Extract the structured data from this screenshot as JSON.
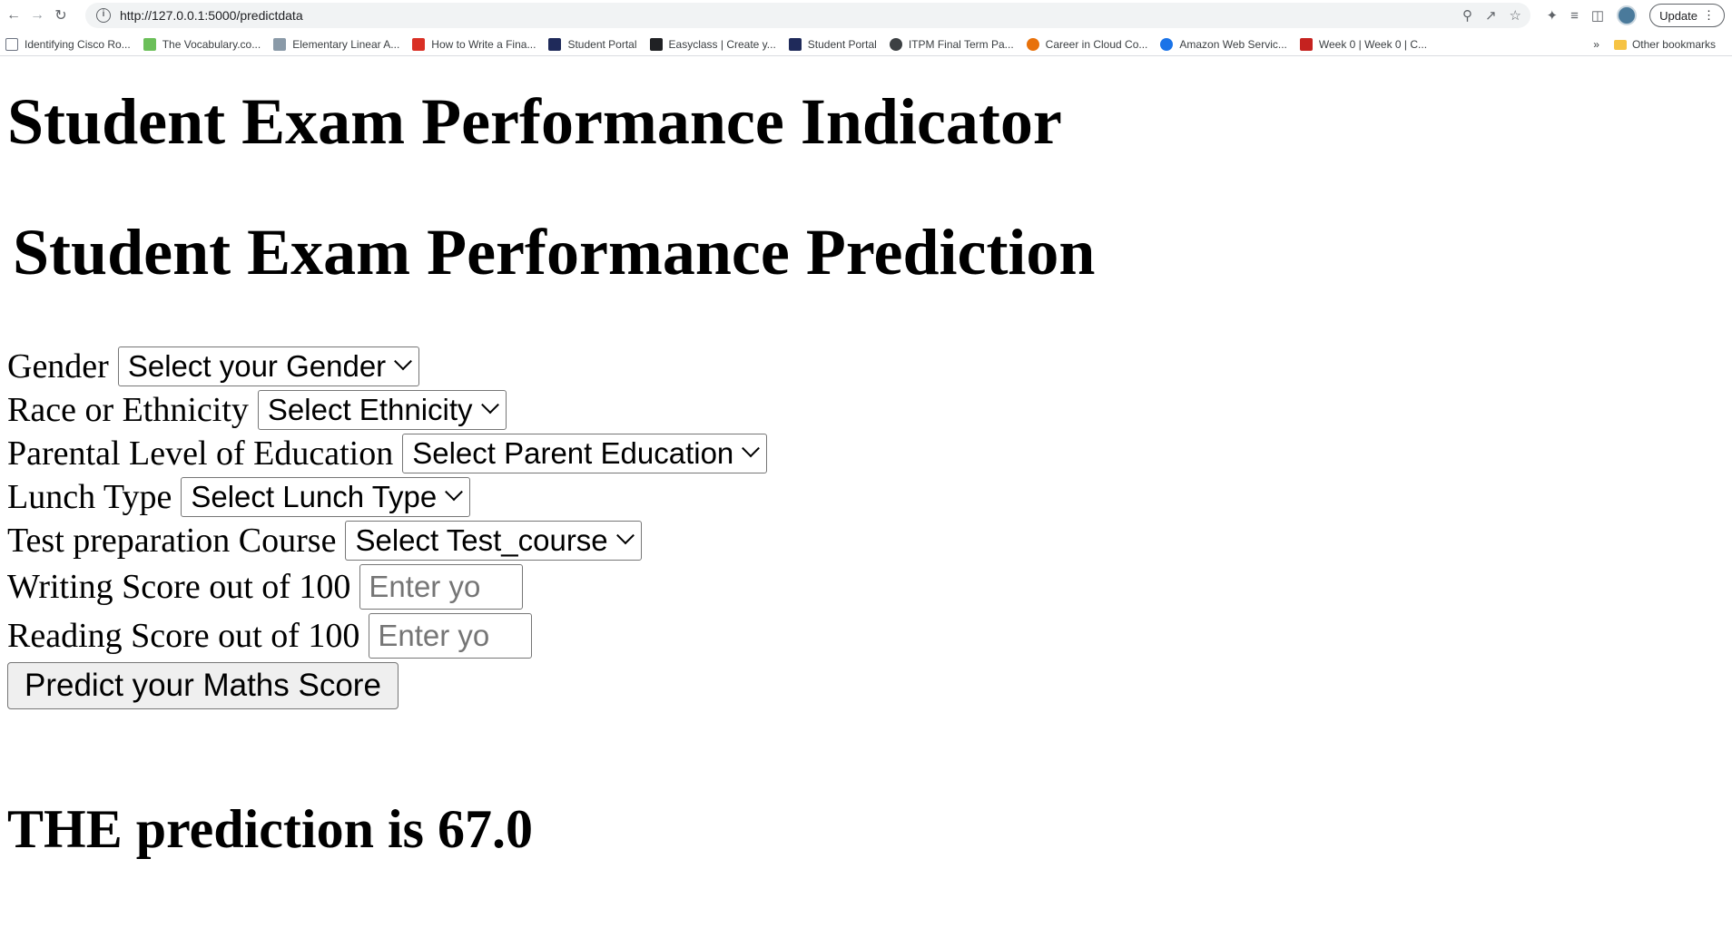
{
  "browser": {
    "url": "http://127.0.0.1:5000/predictdata",
    "update_label": "Update",
    "bookmarks": [
      {
        "label": "Identifying Cisco Ro...",
        "color": "#6b7280"
      },
      {
        "label": "The Vocabulary.co...",
        "color": "#6bbf59"
      },
      {
        "label": "Elementary Linear A...",
        "color": "#8a9aa8"
      },
      {
        "label": "How to Write a Fina...",
        "color": "#d93025"
      },
      {
        "label": "Student Portal",
        "color": "#1f2a5a"
      },
      {
        "label": "Easyclass | Create y...",
        "color": "#202124"
      },
      {
        "label": "Student Portal",
        "color": "#1f2a5a"
      },
      {
        "label": "ITPM Final Term Pa...",
        "color": "#3c4043"
      },
      {
        "label": "Career in Cloud Co...",
        "color": "#e8710a"
      },
      {
        "label": "Amazon Web Servic...",
        "color": "#1a73e8"
      },
      {
        "label": "Week 0 | Week 0 | C...",
        "color": "#c5221f"
      }
    ],
    "more_label": "»",
    "other_bookmarks": "Other bookmarks"
  },
  "page": {
    "title": "Student Exam Performance Indicator",
    "subtitle": "Student Exam Performance Prediction",
    "form": {
      "gender_label": "Gender",
      "gender_select": "Select your Gender",
      "ethnicity_label": "Race or Ethnicity",
      "ethnicity_select": "Select Ethnicity",
      "parent_edu_label": "Parental Level of Education",
      "parent_edu_select": "Select Parent Education",
      "lunch_label": "Lunch Type",
      "lunch_select": "Select Lunch Type",
      "test_prep_label": "Test preparation Course",
      "test_prep_select": "Select Test_course",
      "writing_label": "Writing Score out of 100",
      "writing_placeholder": "Enter yo",
      "reading_label": "Reading Score out of 100",
      "reading_placeholder": "Enter yo",
      "submit_label": "Predict your Maths Score"
    },
    "result": "THE prediction is 67.0"
  }
}
